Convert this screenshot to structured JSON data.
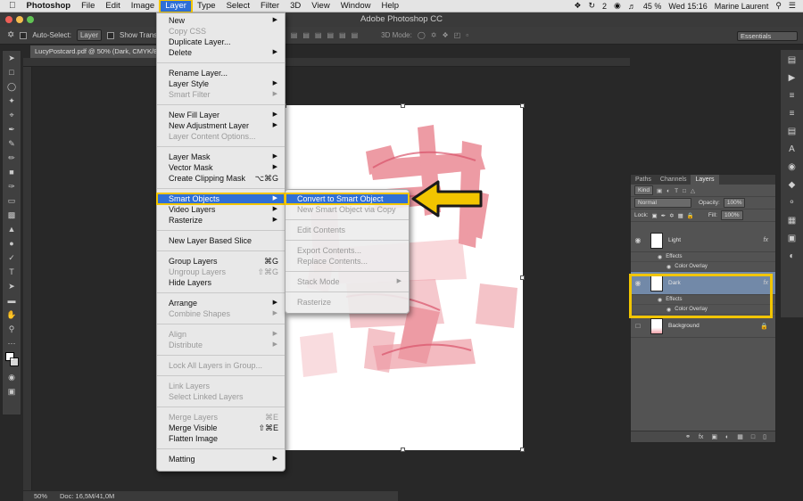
{
  "menubar": {
    "apple": "",
    "app": "Photoshop",
    "items": [
      "File",
      "Edit",
      "Image",
      "Layer",
      "Type",
      "Select",
      "Filter",
      "3D",
      "View",
      "Window",
      "Help"
    ],
    "badge": "2",
    "battery": "45 %",
    "clock": "Wed 15:16",
    "user": "Marine Laurent"
  },
  "window": {
    "title": "Adobe Photoshop CC"
  },
  "options": {
    "auto_select": "Auto-Select:",
    "auto_select_target": "Layer",
    "show_transform": "Show Trans",
    "mode_3d": "3D Mode:",
    "workspace": "Essentials"
  },
  "document": {
    "tab": "LucyPostcard.pdf @ 50% (Dark, CMYK/8*)"
  },
  "status": {
    "zoom": "50%",
    "doc": "Doc: 16,5M/41,0M"
  },
  "layer_menu": {
    "items": [
      {
        "label": "New",
        "arrow": true
      },
      {
        "label": "Copy CSS",
        "disabled": true
      },
      {
        "label": "Duplicate Layer..."
      },
      {
        "label": "Delete",
        "arrow": true
      },
      {
        "sep": true
      },
      {
        "label": "Rename Layer..."
      },
      {
        "label": "Layer Style",
        "arrow": true
      },
      {
        "label": "Smart Filter",
        "disabled": true,
        "arrow": true
      },
      {
        "sep": true
      },
      {
        "label": "New Fill Layer",
        "arrow": true
      },
      {
        "label": "New Adjustment Layer",
        "arrow": true
      },
      {
        "label": "Layer Content Options...",
        "disabled": true
      },
      {
        "sep": true
      },
      {
        "label": "Layer Mask",
        "arrow": true
      },
      {
        "label": "Vector Mask",
        "arrow": true
      },
      {
        "label": "Create Clipping Mask",
        "shortcut": "⌥⌘G"
      },
      {
        "sep": true
      },
      {
        "label": "Smart Objects",
        "arrow": true,
        "highlight": true
      },
      {
        "label": "Video Layers",
        "arrow": true
      },
      {
        "label": "Rasterize",
        "arrow": true
      },
      {
        "sep": true
      },
      {
        "label": "New Layer Based Slice"
      },
      {
        "sep": true
      },
      {
        "label": "Group Layers",
        "shortcut": "⌘G"
      },
      {
        "label": "Ungroup Layers",
        "disabled": true,
        "shortcut": "⇧⌘G"
      },
      {
        "label": "Hide Layers"
      },
      {
        "sep": true
      },
      {
        "label": "Arrange",
        "arrow": true
      },
      {
        "label": "Combine Shapes",
        "disabled": true,
        "arrow": true
      },
      {
        "sep": true
      },
      {
        "label": "Align",
        "disabled": true,
        "arrow": true
      },
      {
        "label": "Distribute",
        "disabled": true,
        "arrow": true
      },
      {
        "sep": true
      },
      {
        "label": "Lock All Layers in Group...",
        "disabled": true
      },
      {
        "sep": true
      },
      {
        "label": "Link Layers",
        "disabled": true
      },
      {
        "label": "Select Linked Layers",
        "disabled": true
      },
      {
        "sep": true
      },
      {
        "label": "Merge Layers",
        "disabled": true,
        "shortcut": "⌘E"
      },
      {
        "label": "Merge Visible",
        "shortcut": "⇧⌘E"
      },
      {
        "label": "Flatten Image"
      },
      {
        "sep": true
      },
      {
        "label": "Matting",
        "arrow": true
      }
    ]
  },
  "smart_submenu": {
    "items": [
      {
        "label": "Convert to Smart Object",
        "highlight": true
      },
      {
        "label": "New Smart Object via Copy",
        "disabled": true
      },
      {
        "sep": true
      },
      {
        "label": "Edit Contents",
        "disabled": true
      },
      {
        "sep": true
      },
      {
        "label": "Export Contents...",
        "disabled": true
      },
      {
        "label": "Replace Contents...",
        "disabled": true
      },
      {
        "sep": true
      },
      {
        "label": "Stack Mode",
        "disabled": true,
        "arrow": true
      },
      {
        "sep": true
      },
      {
        "label": "Rasterize",
        "disabled": true
      }
    ]
  },
  "layers_panel": {
    "tabs": [
      "Paths",
      "Channels",
      "Layers"
    ],
    "filter": "Kind",
    "blend": "Normal",
    "opacity_label": "Opacity:",
    "opacity": "100%",
    "lock_label": "Lock:",
    "fill_label": "Fill:",
    "fill": "100%",
    "layers": [
      {
        "name": "Light",
        "effects_label": "Effects",
        "effect": "Color Overlay"
      },
      {
        "name": "Dark",
        "effects_label": "Effects",
        "effect": "Color Overlay",
        "selected": true
      },
      {
        "name": "Background"
      }
    ]
  },
  "colors": {
    "highlight": "#f2c500",
    "selection": "#2f6fd6"
  }
}
